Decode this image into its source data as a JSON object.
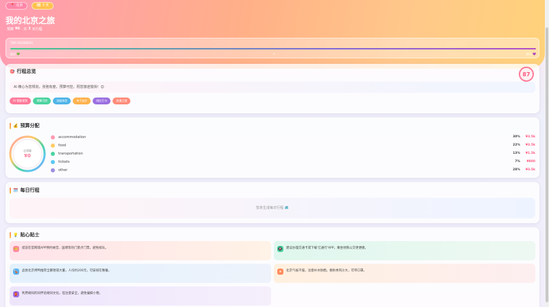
{
  "header": {
    "chips": [
      {
        "icon": "pin-icon",
        "glyph": "📍",
        "label": "北京"
      },
      {
        "icon": "calendar-icon",
        "glyph": "🗓",
        "label": "3 天"
      }
    ],
    "title": "我的北京之旅",
    "subtitle_prefix": "预算",
    "budget": "¥0",
    "subtitle_mid": "· 共",
    "days": "3",
    "subtitle_suffix": "天行程"
  },
  "progress": {
    "label": "TRIP READINESS",
    "value": 1.0,
    "mark_start": "起点 💚",
    "mark_mid": "✈︎",
    "mark_end": "终点 💜"
  },
  "overview": {
    "icon": "target-icon",
    "glyph": "🎯",
    "title": "行程总览",
    "score": "87",
    "ai_text": "AI 精心为您规划，张弛有度，预算可控，祝您旅途愉快！😊",
    "tags": [
      {
        "label": "AI 智能规划",
        "color": "#ff7a9a"
      },
      {
        "label": "预算可控",
        "color": "#4cd3a0"
      },
      {
        "label": "深度体验",
        "color": "#4fb4e8"
      },
      {
        "label": "亲子友好",
        "color": "#ffb24d"
      },
      {
        "label": "网红打卡",
        "color": "#9b6fe0"
      },
      {
        "label": "浪漫之旅",
        "color": "#ff8c7a"
      }
    ]
  },
  "budget": {
    "glyph": "💰",
    "title": "预算分配",
    "total_label": "总预算",
    "total": "¥0",
    "categories": [
      {
        "name": "accommodation",
        "pct": "30%",
        "amount": "¥3.5k",
        "color": "#ff9bb3"
      },
      {
        "name": "food",
        "pct": "22%",
        "amount": "¥3.5k",
        "color": "#ffcc66"
      },
      {
        "name": "transportation",
        "pct": "13%",
        "amount": "¥1.5k",
        "color": "#4cd3a0"
      },
      {
        "name": "tickets",
        "pct": "7%",
        "amount": "¥800",
        "color": "#5cc8f0"
      },
      {
        "name": "other",
        "pct": "28%",
        "amount": "¥3.5k",
        "color": "#9b8fe0"
      }
    ]
  },
  "daily": {
    "glyph": "🗓️",
    "title": "每日行程",
    "empty_text": "暂未生成每日行程 🗺️"
  },
  "tips": {
    "glyph": "💡",
    "title": "贴心贴士",
    "items": [
      {
        "text": "提前在官网或APP预约故宫、国博等热门景点门票，避免排队。",
        "icon": "ticket-icon",
        "glyph": "🎫",
        "color": "#ff8aa5",
        "bg": "linear-gradient(90deg,#ffe3ea,#fff2e6)"
      },
      {
        "text": "建议办理交通卡或下载'亿通行'APP，乘坐地铁公交更便捷。",
        "icon": "subway-icon",
        "glyph": "🚇",
        "color": "#4cd3a0",
        "bg": "linear-gradient(90deg,#dff7ee,#eef8f2)"
      },
      {
        "text": "品尝北京烤鸭推荐全聚德或大董，人均约200元，可安排在晚餐。",
        "icon": "food-icon",
        "glyph": "🍗",
        "color": "#5cb4f0",
        "bg": "linear-gradient(90deg,#e3f1fd,#eef3fb)"
      },
      {
        "text": "北京气候干燥，注意补水防晒，春秋季风沙大，可带口罩。",
        "icon": "weather-icon",
        "glyph": "☀",
        "color": "#ff8c5c",
        "bg": "linear-gradient(90deg,#fff0e0,#fdeef0)"
      },
      {
        "text": "利用胡同的同伴验胡同文化，但注意安全，避免偏僻小巷。",
        "icon": "lantern-icon",
        "glyph": "🏮",
        "color": "#a46fe0",
        "bg": "linear-gradient(90deg,#eee5fb,#f5effc)"
      }
    ]
  }
}
